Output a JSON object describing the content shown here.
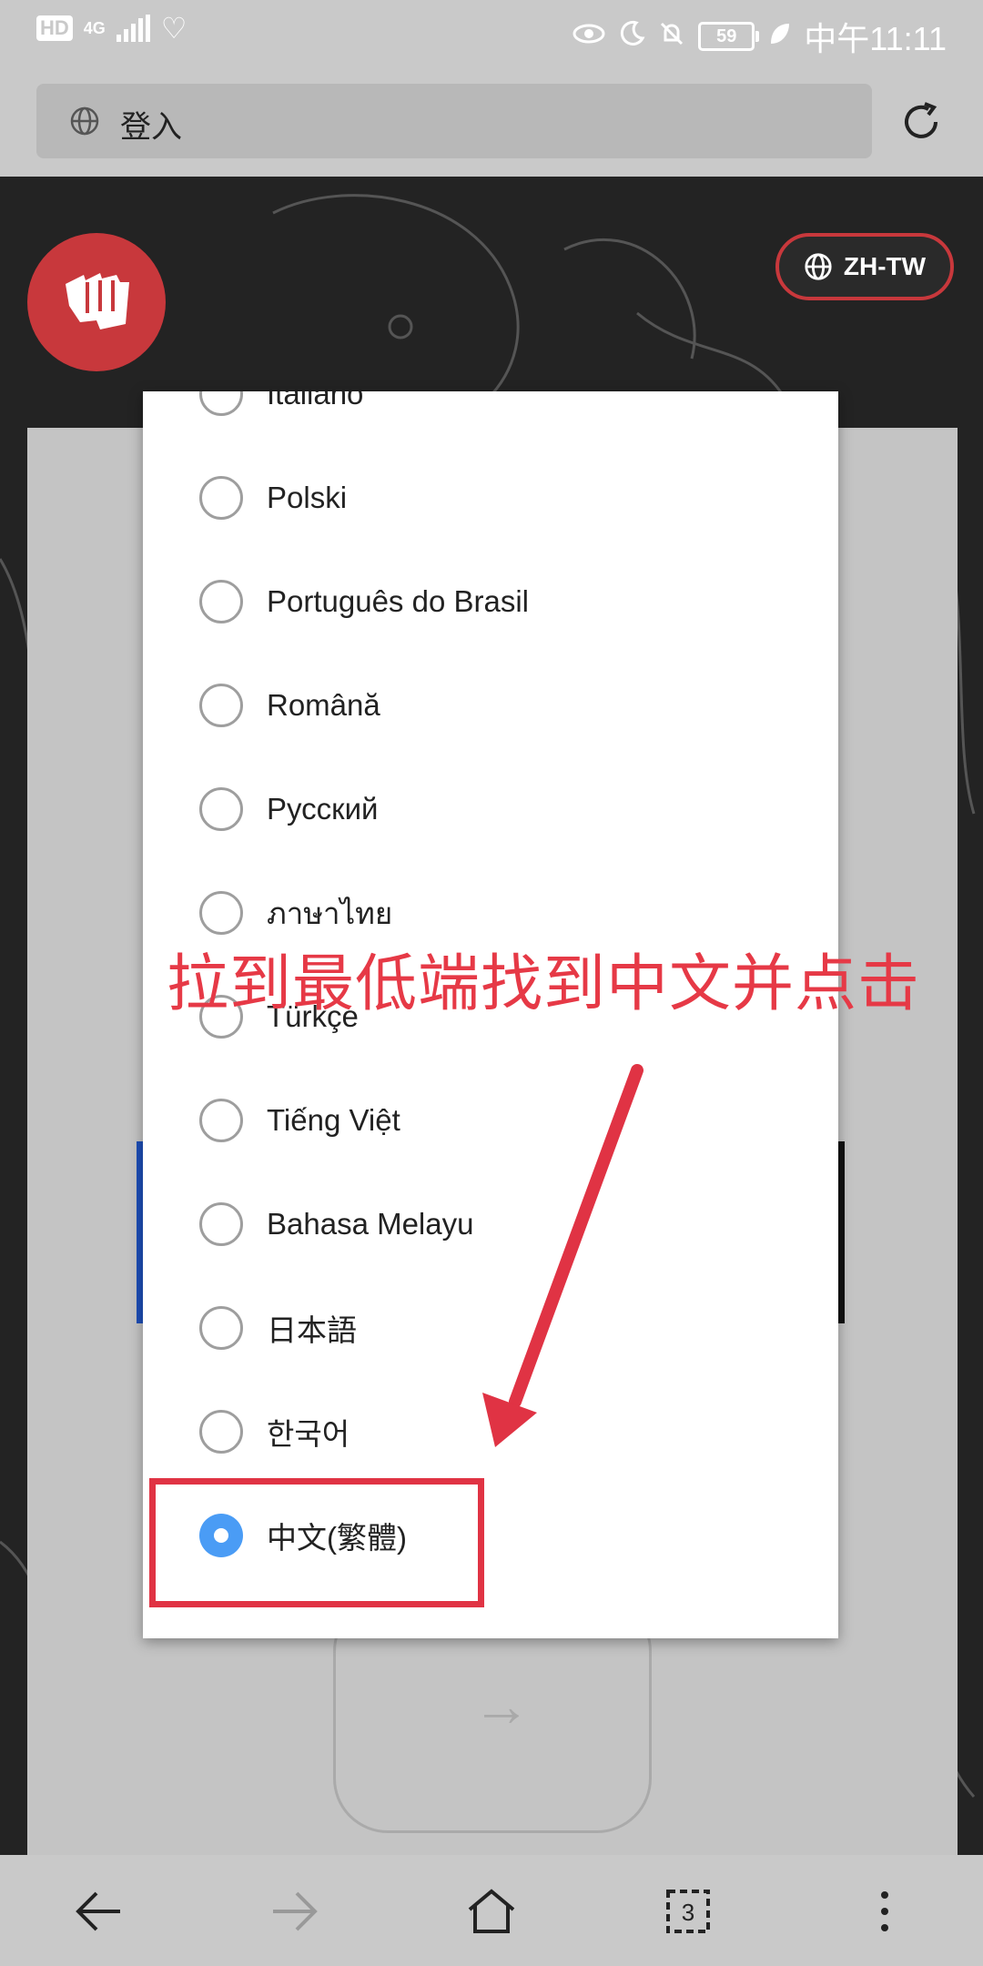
{
  "status_bar": {
    "hd_badge": "HD",
    "network": "4G",
    "battery": "59",
    "time": "中午11:11",
    "icons": [
      "eye-icon",
      "moon-icon",
      "mute-icon",
      "leaf-icon"
    ]
  },
  "url_bar": {
    "title": "登入"
  },
  "header": {
    "language_button": "ZH-TW"
  },
  "dialog": {
    "options": [
      {
        "label": "Italiano",
        "selected": false
      },
      {
        "label": "Polski",
        "selected": false
      },
      {
        "label": "Português do Brasil",
        "selected": false
      },
      {
        "label": "Română",
        "selected": false
      },
      {
        "label": "Русский",
        "selected": false
      },
      {
        "label": "ภาษาไทย",
        "selected": false
      },
      {
        "label": "Türkçe",
        "selected": false
      },
      {
        "label": "Tiếng Việt",
        "selected": false
      },
      {
        "label": "Bahasa Melayu",
        "selected": false
      },
      {
        "label": "日本語",
        "selected": false
      },
      {
        "label": "한국어",
        "selected": false
      },
      {
        "label": "中文(繁體)",
        "selected": true
      }
    ]
  },
  "annotation": {
    "text": "拉到最低端找到中文并点击"
  },
  "colors": {
    "accent_red": "#c8383c",
    "annotation_red": "#e63946",
    "radio_selected": "#4a9cf5"
  }
}
